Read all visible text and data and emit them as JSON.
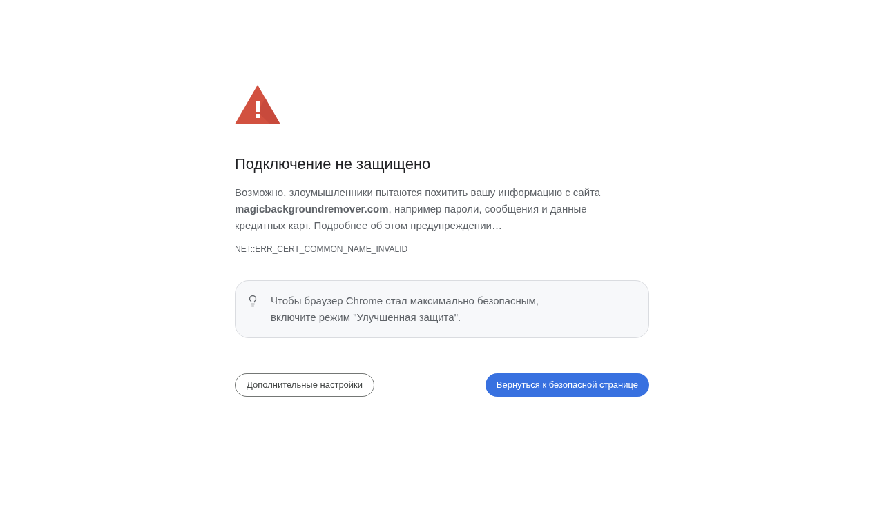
{
  "title": "Подключение не защищено",
  "description": {
    "text": "Возможно, злоумышленники пытаются похитить вашу информацию с сайта **magicbackgroundremover.com**, например пароли, сообщения и данные кредитных карт. Подробнее",
    "link": "об этом предупреждении",
    "suffix": "…"
  },
  "error_code": "NET::ERR_CERT_COMMON_NAME_INVALID",
  "tip": {
    "text": "Чтобы браузер Chrome стал максимально безопасным,",
    "link": "включите режим \"Улучшенная защита\"",
    "suffix": "."
  },
  "buttons": [
    {
      "label": "Дополнительные настройки",
      "kind": "secondary"
    },
    {
      "label": "Вернуться к безопасной странице",
      "kind": "primary"
    }
  ]
}
